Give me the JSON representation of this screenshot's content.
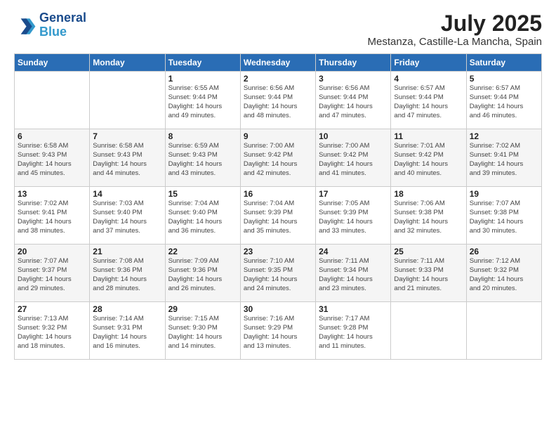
{
  "logo": {
    "line1": "General",
    "line2": "Blue"
  },
  "title": "July 2025",
  "location": "Mestanza, Castille-La Mancha, Spain",
  "days_of_week": [
    "Sunday",
    "Monday",
    "Tuesday",
    "Wednesday",
    "Thursday",
    "Friday",
    "Saturday"
  ],
  "weeks": [
    [
      {
        "day": "",
        "info": ""
      },
      {
        "day": "",
        "info": ""
      },
      {
        "day": "1",
        "info": "Sunrise: 6:55 AM\nSunset: 9:44 PM\nDaylight: 14 hours\nand 49 minutes."
      },
      {
        "day": "2",
        "info": "Sunrise: 6:56 AM\nSunset: 9:44 PM\nDaylight: 14 hours\nand 48 minutes."
      },
      {
        "day": "3",
        "info": "Sunrise: 6:56 AM\nSunset: 9:44 PM\nDaylight: 14 hours\nand 47 minutes."
      },
      {
        "day": "4",
        "info": "Sunrise: 6:57 AM\nSunset: 9:44 PM\nDaylight: 14 hours\nand 47 minutes."
      },
      {
        "day": "5",
        "info": "Sunrise: 6:57 AM\nSunset: 9:44 PM\nDaylight: 14 hours\nand 46 minutes."
      }
    ],
    [
      {
        "day": "6",
        "info": "Sunrise: 6:58 AM\nSunset: 9:43 PM\nDaylight: 14 hours\nand 45 minutes."
      },
      {
        "day": "7",
        "info": "Sunrise: 6:58 AM\nSunset: 9:43 PM\nDaylight: 14 hours\nand 44 minutes."
      },
      {
        "day": "8",
        "info": "Sunrise: 6:59 AM\nSunset: 9:43 PM\nDaylight: 14 hours\nand 43 minutes."
      },
      {
        "day": "9",
        "info": "Sunrise: 7:00 AM\nSunset: 9:42 PM\nDaylight: 14 hours\nand 42 minutes."
      },
      {
        "day": "10",
        "info": "Sunrise: 7:00 AM\nSunset: 9:42 PM\nDaylight: 14 hours\nand 41 minutes."
      },
      {
        "day": "11",
        "info": "Sunrise: 7:01 AM\nSunset: 9:42 PM\nDaylight: 14 hours\nand 40 minutes."
      },
      {
        "day": "12",
        "info": "Sunrise: 7:02 AM\nSunset: 9:41 PM\nDaylight: 14 hours\nand 39 minutes."
      }
    ],
    [
      {
        "day": "13",
        "info": "Sunrise: 7:02 AM\nSunset: 9:41 PM\nDaylight: 14 hours\nand 38 minutes."
      },
      {
        "day": "14",
        "info": "Sunrise: 7:03 AM\nSunset: 9:40 PM\nDaylight: 14 hours\nand 37 minutes."
      },
      {
        "day": "15",
        "info": "Sunrise: 7:04 AM\nSunset: 9:40 PM\nDaylight: 14 hours\nand 36 minutes."
      },
      {
        "day": "16",
        "info": "Sunrise: 7:04 AM\nSunset: 9:39 PM\nDaylight: 14 hours\nand 35 minutes."
      },
      {
        "day": "17",
        "info": "Sunrise: 7:05 AM\nSunset: 9:39 PM\nDaylight: 14 hours\nand 33 minutes."
      },
      {
        "day": "18",
        "info": "Sunrise: 7:06 AM\nSunset: 9:38 PM\nDaylight: 14 hours\nand 32 minutes."
      },
      {
        "day": "19",
        "info": "Sunrise: 7:07 AM\nSunset: 9:38 PM\nDaylight: 14 hours\nand 30 minutes."
      }
    ],
    [
      {
        "day": "20",
        "info": "Sunrise: 7:07 AM\nSunset: 9:37 PM\nDaylight: 14 hours\nand 29 minutes."
      },
      {
        "day": "21",
        "info": "Sunrise: 7:08 AM\nSunset: 9:36 PM\nDaylight: 14 hours\nand 28 minutes."
      },
      {
        "day": "22",
        "info": "Sunrise: 7:09 AM\nSunset: 9:36 PM\nDaylight: 14 hours\nand 26 minutes."
      },
      {
        "day": "23",
        "info": "Sunrise: 7:10 AM\nSunset: 9:35 PM\nDaylight: 14 hours\nand 24 minutes."
      },
      {
        "day": "24",
        "info": "Sunrise: 7:11 AM\nSunset: 9:34 PM\nDaylight: 14 hours\nand 23 minutes."
      },
      {
        "day": "25",
        "info": "Sunrise: 7:11 AM\nSunset: 9:33 PM\nDaylight: 14 hours\nand 21 minutes."
      },
      {
        "day": "26",
        "info": "Sunrise: 7:12 AM\nSunset: 9:32 PM\nDaylight: 14 hours\nand 20 minutes."
      }
    ],
    [
      {
        "day": "27",
        "info": "Sunrise: 7:13 AM\nSunset: 9:32 PM\nDaylight: 14 hours\nand 18 minutes."
      },
      {
        "day": "28",
        "info": "Sunrise: 7:14 AM\nSunset: 9:31 PM\nDaylight: 14 hours\nand 16 minutes."
      },
      {
        "day": "29",
        "info": "Sunrise: 7:15 AM\nSunset: 9:30 PM\nDaylight: 14 hours\nand 14 minutes."
      },
      {
        "day": "30",
        "info": "Sunrise: 7:16 AM\nSunset: 9:29 PM\nDaylight: 14 hours\nand 13 minutes."
      },
      {
        "day": "31",
        "info": "Sunrise: 7:17 AM\nSunset: 9:28 PM\nDaylight: 14 hours\nand 11 minutes."
      },
      {
        "day": "",
        "info": ""
      },
      {
        "day": "",
        "info": ""
      }
    ]
  ]
}
